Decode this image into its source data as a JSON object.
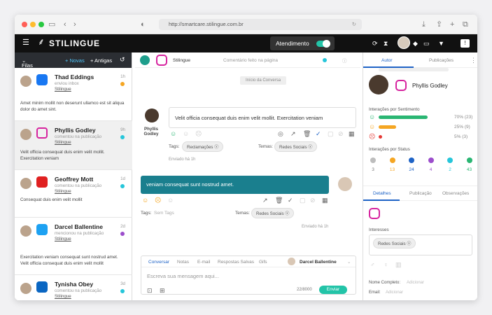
{
  "browser": {
    "url": "http://smartcare.stilingue.com.br"
  },
  "nav": {
    "logo": "STILINGUE",
    "atendimento": "Atendimento"
  },
  "left": {
    "filas": "Filas",
    "novas": "+ Novas",
    "antigas": "+ Antigas",
    "conversations": [
      {
        "name": "Thad Eddings",
        "sub": "enviou inbox",
        "source": "Stilingue",
        "time": "1h",
        "network": "facebook",
        "dot": "#f5a623",
        "msg": "Amet minim mollit non deserunt ullamco est sit aliqua dolor do amet sint."
      },
      {
        "name": "Phyllis Godley",
        "sub": "comentou na publicação",
        "source": "Stilingue",
        "time": "9h",
        "network": "instagram",
        "dot": "#26c6da",
        "msg": "Velit officia consequat duis enim velit mollit. Exercitation veniam"
      },
      {
        "name": "Geoffrey Mott",
        "sub": "comentou na publicação",
        "source": "Stilingue",
        "time": "1d",
        "network": "youtube",
        "dot": "#26c6da",
        "msg": "Consequat duis enim velit mollit"
      },
      {
        "name": "Darcel Ballentine",
        "sub": "mencionou na publicação",
        "source": "Stilingue",
        "time": "2d",
        "network": "twitter",
        "dot": "#9c4dcc",
        "msg": "Exercitation veniam consequat sunt nostrud amet. Velit officia consequat duis enim velit mollit"
      },
      {
        "name": "Tynisha Obey",
        "sub": "comentou na publicação",
        "source": "Stilingue",
        "time": "3d",
        "network": "linkedin",
        "dot": "#26c6da",
        "msg": ""
      }
    ]
  },
  "mid": {
    "brand": "Stilingue",
    "context": "Comentário feito na página",
    "start": "Início da Conversa",
    "msg1": {
      "author": "Phyllis Godley",
      "text": "Velit officia consequat duis enim velit mollit. Exercitation veniam",
      "tags_label": "Tags:",
      "tag": "Reclamações",
      "temas_label": "Temas:",
      "tema": "Redes Sociais",
      "sent": "Enviado há 1h"
    },
    "msg2": {
      "text": "veniam consequat sunt nostrud amet.",
      "tags_label": "Tags:",
      "tags_empty": "Sem Tags",
      "temas_label": "Temas:",
      "tema": "Redes Sociais",
      "sent": "Enviado há 1h"
    },
    "composer": {
      "tabs": [
        "Conversar",
        "Notas",
        "E-mail",
        "Respostas Salvas",
        "Gifs"
      ],
      "agent": "Darcel Ballentine",
      "placeholder": "Escreva sua mensagem aqui...",
      "count": "22/8000",
      "send": "Enviar"
    }
  },
  "right": {
    "tabs": [
      "Autor",
      "Publicações"
    ],
    "name": "Phyllis Godley",
    "sentiment_title": "Interações por Sentimento",
    "sentiment": [
      {
        "label": "70% (23)",
        "value": 0.7,
        "color": "#2ab673"
      },
      {
        "label": "25% (9)",
        "value": 0.25,
        "color": "#f5a623"
      },
      {
        "label": "5% (3)",
        "value": 0.05,
        "color": "#e53935"
      }
    ],
    "status_title": "Interações por Status",
    "status": [
      {
        "n": "3",
        "color": "#bdbdbd",
        "tc": "#777"
      },
      {
        "n": "13",
        "color": "#f5a623",
        "tc": "#f5a623"
      },
      {
        "n": "24",
        "color": "#1e63c6",
        "tc": "#1e63c6"
      },
      {
        "n": "4",
        "color": "#9c4dcc",
        "tc": "#9c4dcc"
      },
      {
        "n": "2",
        "color": "#26c6da",
        "tc": "#26c6da"
      },
      {
        "n": "43",
        "color": "#2ab673",
        "tc": "#2ab673"
      }
    ],
    "subtabs": [
      "Detalhes",
      "Publicação",
      "Observações"
    ],
    "interesses": "Interesses",
    "interest_tag": "Redes Sociais",
    "nome_label": "Nome Completo:",
    "nome_ph": "Adicionar",
    "email_label": "Email:",
    "email_ph": "Adicionar"
  }
}
